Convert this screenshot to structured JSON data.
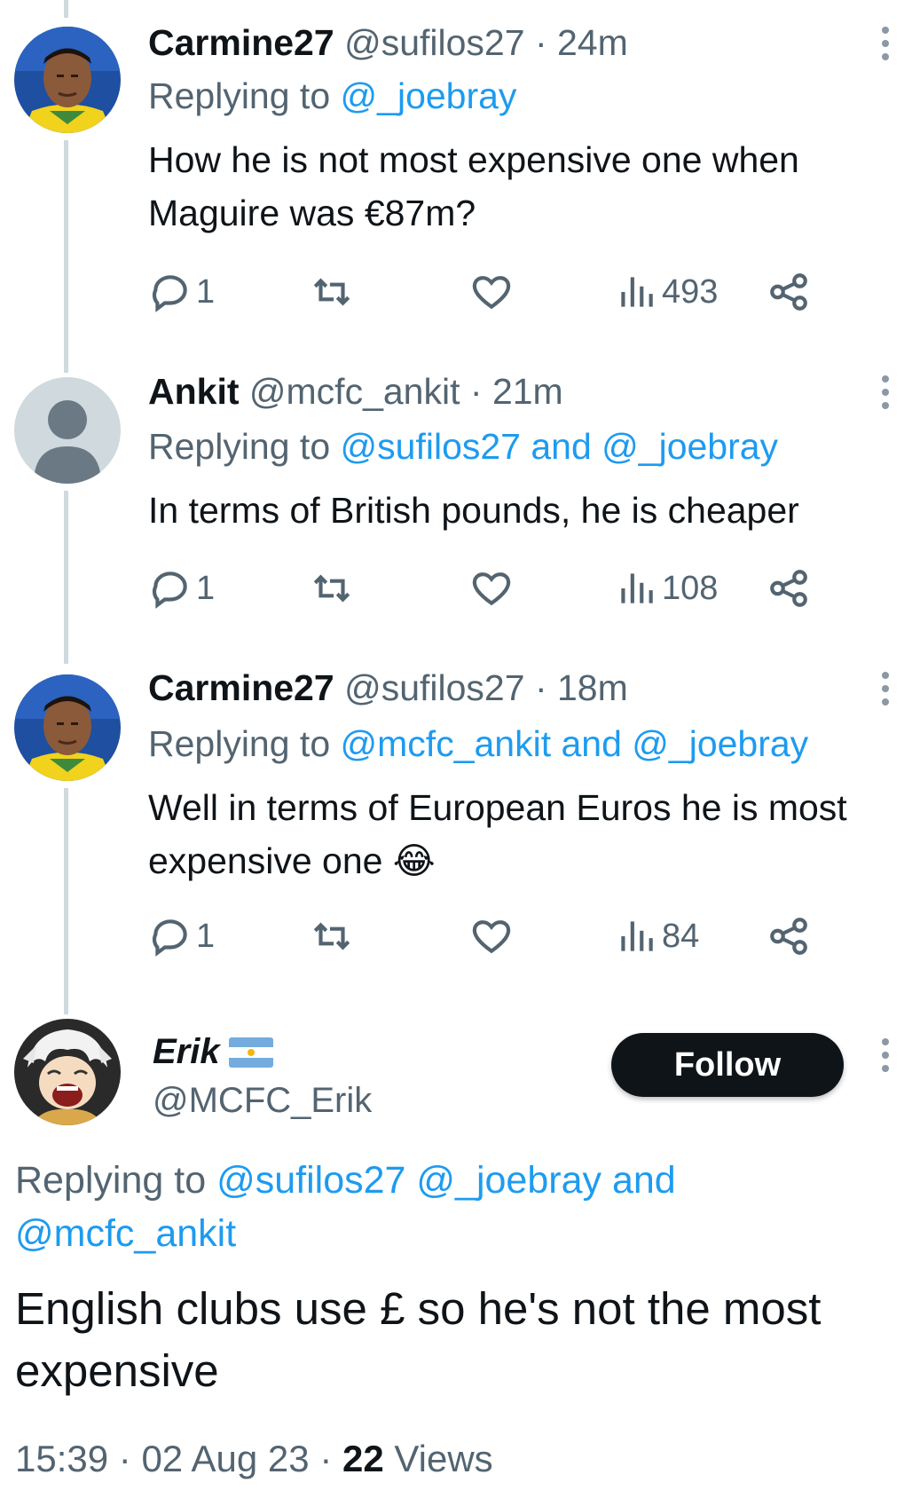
{
  "tweets": [
    {
      "name": "Carmine27",
      "handle": "@sufilos27",
      "sep": "·",
      "time": "24m",
      "replying_prefix": "Replying to",
      "replying_mentions": "@_joebray",
      "text": "How he is not most expensive one when Maguire was €87m?",
      "replies": "1",
      "views": "493"
    },
    {
      "name": "Ankit",
      "handle": "@mcfc_ankit",
      "sep": "·",
      "time": "21m",
      "replying_prefix": "Replying to",
      "replying_mentions": "@sufilos27 and @_joebray",
      "text": "In terms of British pounds,  he is cheaper",
      "replies": "1",
      "views": "108"
    },
    {
      "name": "Carmine27",
      "handle": "@sufilos27",
      "sep": "·",
      "time": "18m",
      "replying_prefix": "Replying to",
      "replying_mentions": "@mcfc_ankit and @_joebray",
      "text": "Well in terms of European Euros he is most expensive one 😂",
      "replies": "1",
      "views": "84"
    }
  ],
  "main_tweet": {
    "name": "Erik",
    "handle": "@MCFC_Erik",
    "follow_label": "Follow",
    "replying_prefix": "Replying to",
    "replying_mentions": "@sufilos27 @_joebray and @mcfc_ankit",
    "text": "English clubs use £ so he's not the most expensive",
    "time": "15:39",
    "sep": "·",
    "date": "02 Aug 23",
    "views_count": "22",
    "views_label": "Views"
  },
  "colors": {
    "link": "#1d9bf0",
    "secondary_text": "#536471",
    "thread_line": "#cfd9de",
    "button_bg": "#0f1419"
  },
  "icons": [
    "reply-icon",
    "retweet-icon",
    "like-icon",
    "views-icon",
    "share-icon",
    "more-icon",
    "argentina-flag-icon"
  ]
}
